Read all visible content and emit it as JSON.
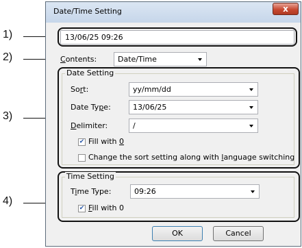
{
  "window": {
    "title": "Date/Time Setting",
    "close_glyph": "x"
  },
  "callouts": [
    "1)",
    "2)",
    "3)",
    "4)"
  ],
  "preview": {
    "value": "13/06/25  09:26"
  },
  "contents": {
    "label_key": "C",
    "label_rest": "ontents:",
    "value": "Date/Time"
  },
  "date_setting": {
    "legend": "Date Setting",
    "sort_label_pre": "So",
    "sort_label_key": "r",
    "sort_label_post": "t:",
    "sort_value": "yy/mm/dd",
    "date_type_label_pre": "Date Ty",
    "date_type_label_key": "p",
    "date_type_label_post": "e:",
    "date_type_value": "13/06/25",
    "delimiter_label_key": "D",
    "delimiter_label_rest": "elimiter:",
    "delimiter_value": "/",
    "fill_pre": "Fill with ",
    "fill_key": "0",
    "fill_checked": true,
    "change_sort_pre": "Change the sort setting along with ",
    "change_sort_key": "l",
    "change_sort_post": "anguage switching",
    "change_sort_checked": false
  },
  "time_setting": {
    "legend": "Time Setting",
    "time_type_label_pre": "T",
    "time_type_label_key": "i",
    "time_type_label_post": "me Type:",
    "time_type_value": "09:26",
    "fill_key": "F",
    "fill_rest": "ill with 0",
    "fill_checked": true
  },
  "buttons": {
    "ok": "OK",
    "cancel": "Cancel"
  },
  "icons": {
    "dropdown": "chevron-down-icon",
    "check": "checkmark-icon"
  },
  "colors": {
    "titlebar": "#c6d6ea",
    "close": "#c84a32",
    "dialog_bg": "#f0f0f0"
  }
}
